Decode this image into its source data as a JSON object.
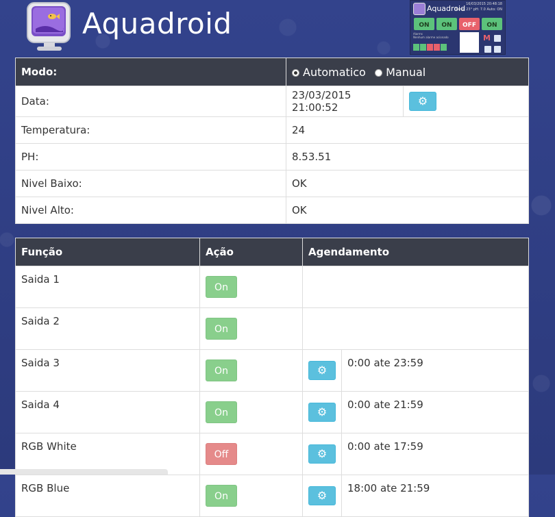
{
  "brand": {
    "title": "Aquadroid"
  },
  "thumbnail": {
    "title": "Aquadroid",
    "date": "16/03/2015 20:48:18",
    "summary": "Temp: 23° pH: 7.0 Auto: ON",
    "buttons": [
      "ON",
      "ON",
      "OFF",
      "ON"
    ],
    "alarm_label": "Alarms",
    "alarm_text": "Nenhum alarme acionado"
  },
  "status_table": {
    "mode_label": "Modo:",
    "mode_options": [
      "Automatico",
      "Manual"
    ],
    "mode_selected": "Automatico",
    "rows": [
      {
        "label": "Data:",
        "value": "23/03/2015 21:00:52",
        "has_settings": true
      },
      {
        "label": "Temperatura:",
        "value": "24"
      },
      {
        "label": "PH:",
        "value": "8.53.51"
      },
      {
        "label": "Nivel Baixo:",
        "value": "OK"
      },
      {
        "label": "Nivel Alto:",
        "value": "OK"
      }
    ]
  },
  "outputs_table": {
    "headers": {
      "function": "Função",
      "action": "Ação",
      "schedule": "Agendamento"
    },
    "rows": [
      {
        "name": "Saida 1",
        "state": "On",
        "schedule": ""
      },
      {
        "name": "Saida 2",
        "state": "On",
        "schedule": ""
      },
      {
        "name": "Saida 3",
        "state": "On",
        "schedule": "0:00 ate 23:59"
      },
      {
        "name": "Saida 4",
        "state": "On",
        "schedule": "0:00 ate 21:59"
      },
      {
        "name": "RGB White",
        "state": "Off",
        "schedule": "0:00 ate 17:59"
      },
      {
        "name": "RGB Blue",
        "state": "On",
        "schedule": "18:00 ate 21:59"
      }
    ]
  },
  "colors": {
    "header_bg": "#3a3e4a",
    "settings_button": "#5bc0de",
    "on_button": "#89cf8c",
    "off_button": "#e58a8a",
    "page_bg": "#2f3f86"
  },
  "icons": {
    "settings": "gear-icon",
    "logo": "aquarium-monitor-logo"
  }
}
